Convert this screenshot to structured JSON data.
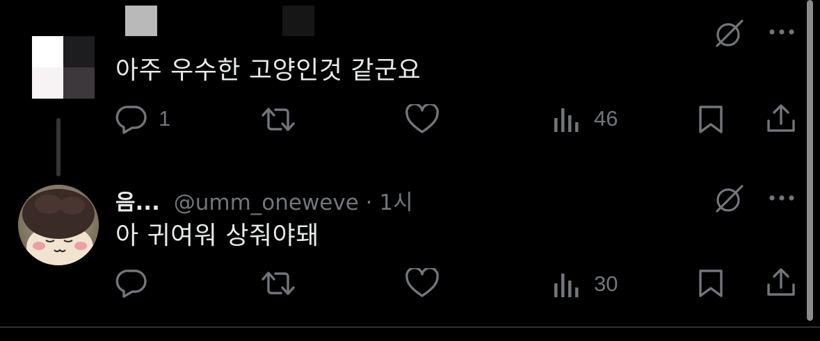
{
  "reply1": {
    "text": "아주 우수한 고양인것 같군요",
    "reply_count": "1",
    "view_count": "46",
    "icons": [
      "grok-icon",
      "more-icon",
      "reply-icon",
      "retweet-icon",
      "like-icon",
      "views-icon",
      "bookmark-icon",
      "share-icon"
    ]
  },
  "reply2": {
    "display_name": "음...",
    "handle": "@umm_oneweve",
    "separator": "·",
    "time": "1시",
    "text": "아 귀여워 상줘야돼",
    "view_count": "30",
    "icons": [
      "grok-icon",
      "more-icon",
      "reply-icon",
      "retweet-icon",
      "like-icon",
      "views-icon",
      "bookmark-icon",
      "share-icon"
    ]
  },
  "colors": {
    "background": "#000000",
    "text": "#e7e9ea",
    "muted": "#71767b",
    "thread_line": "#333639"
  }
}
